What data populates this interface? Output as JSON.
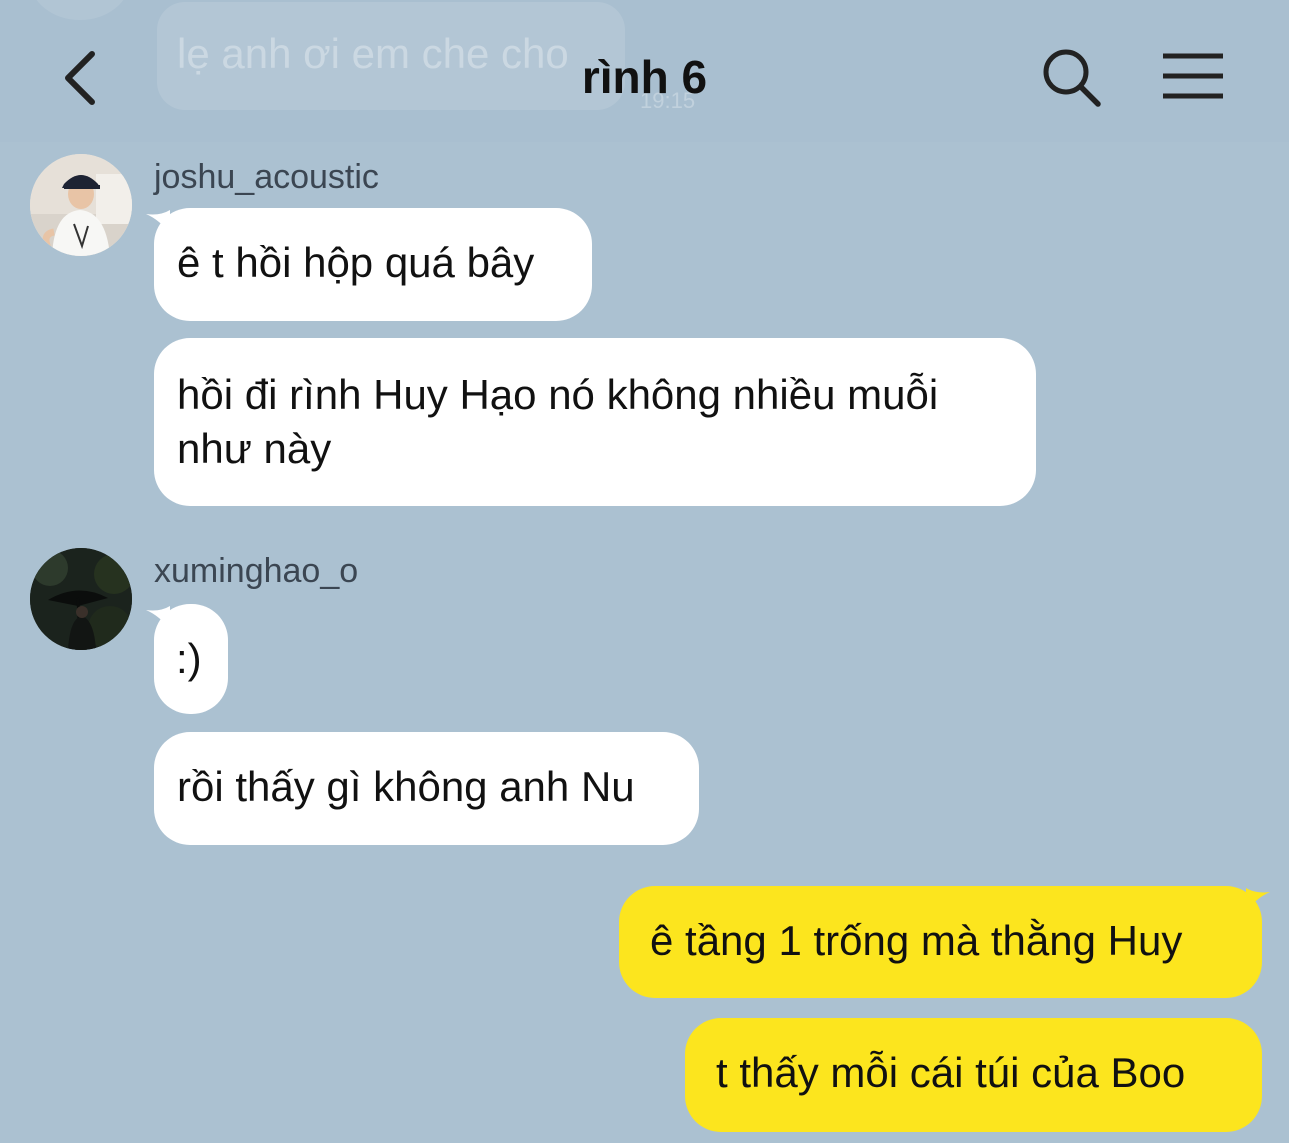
{
  "header": {
    "title": "rình 6",
    "back_icon": "chevron-left-icon",
    "search_icon": "search-icon",
    "menu_icon": "hamburger-menu-icon"
  },
  "background_preview": {
    "text": "lẹ anh ơi em che cho",
    "time": "19:15"
  },
  "colors": {
    "background": "#abc1d1",
    "incoming_bubble": "#ffffff",
    "outgoing_bubble": "#fce51e"
  },
  "messages": [
    {
      "sender": "joshu_acoustic",
      "text": "ê t hồi hộp quá bây"
    },
    {
      "sender": "joshu_acoustic",
      "text": "hồi đi rình Huy Hạo nó không nhiều muỗi như này"
    },
    {
      "sender": "xuminghao_o",
      "text": ":)"
    },
    {
      "sender": "xuminghao_o",
      "text": "rồi thấy gì không anh Nu"
    },
    {
      "sender": "me",
      "text": "ê tầng 1 trống mà thằng Huy"
    },
    {
      "sender": "me",
      "text": "t thấy mỗi cái túi của Boo"
    }
  ]
}
